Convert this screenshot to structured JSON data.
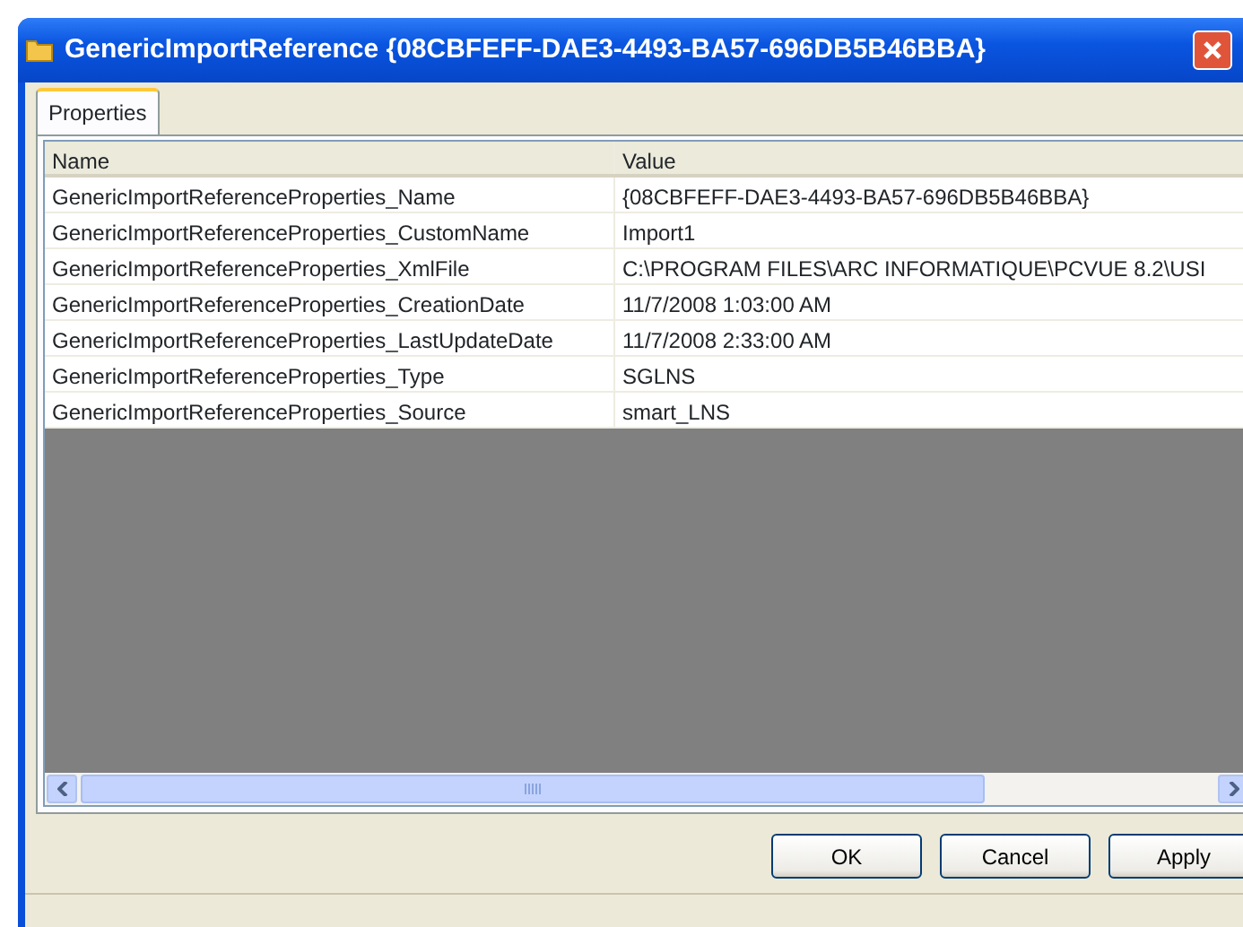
{
  "window": {
    "title": "GenericImportReference {08CBFEFF-DAE3-4493-BA57-696DB5B46BBA}"
  },
  "tabs": [
    {
      "label": "Properties",
      "selected": true
    }
  ],
  "grid": {
    "columns": [
      "Name",
      "Value"
    ],
    "rows": [
      {
        "name": "GenericImportReferenceProperties_Name",
        "value": "{08CBFEFF-DAE3-4493-BA57-696DB5B46BBA}"
      },
      {
        "name": "GenericImportReferenceProperties_CustomName",
        "value": "Import1"
      },
      {
        "name": "GenericImportReferenceProperties_XmlFile",
        "value": "C:\\PROGRAM FILES\\ARC INFORMATIQUE\\PCVUE 8.2\\USI"
      },
      {
        "name": "GenericImportReferenceProperties_CreationDate",
        "value": "11/7/2008 1:03:00 AM"
      },
      {
        "name": "GenericImportReferenceProperties_LastUpdateDate",
        "value": "11/7/2008 2:33:00 AM"
      },
      {
        "name": "GenericImportReferenceProperties_Type",
        "value": "SGLNS"
      },
      {
        "name": "GenericImportReferenceProperties_Source",
        "value": "smart_LNS"
      }
    ]
  },
  "buttons": [
    "OK",
    "Cancel",
    "Apply"
  ]
}
